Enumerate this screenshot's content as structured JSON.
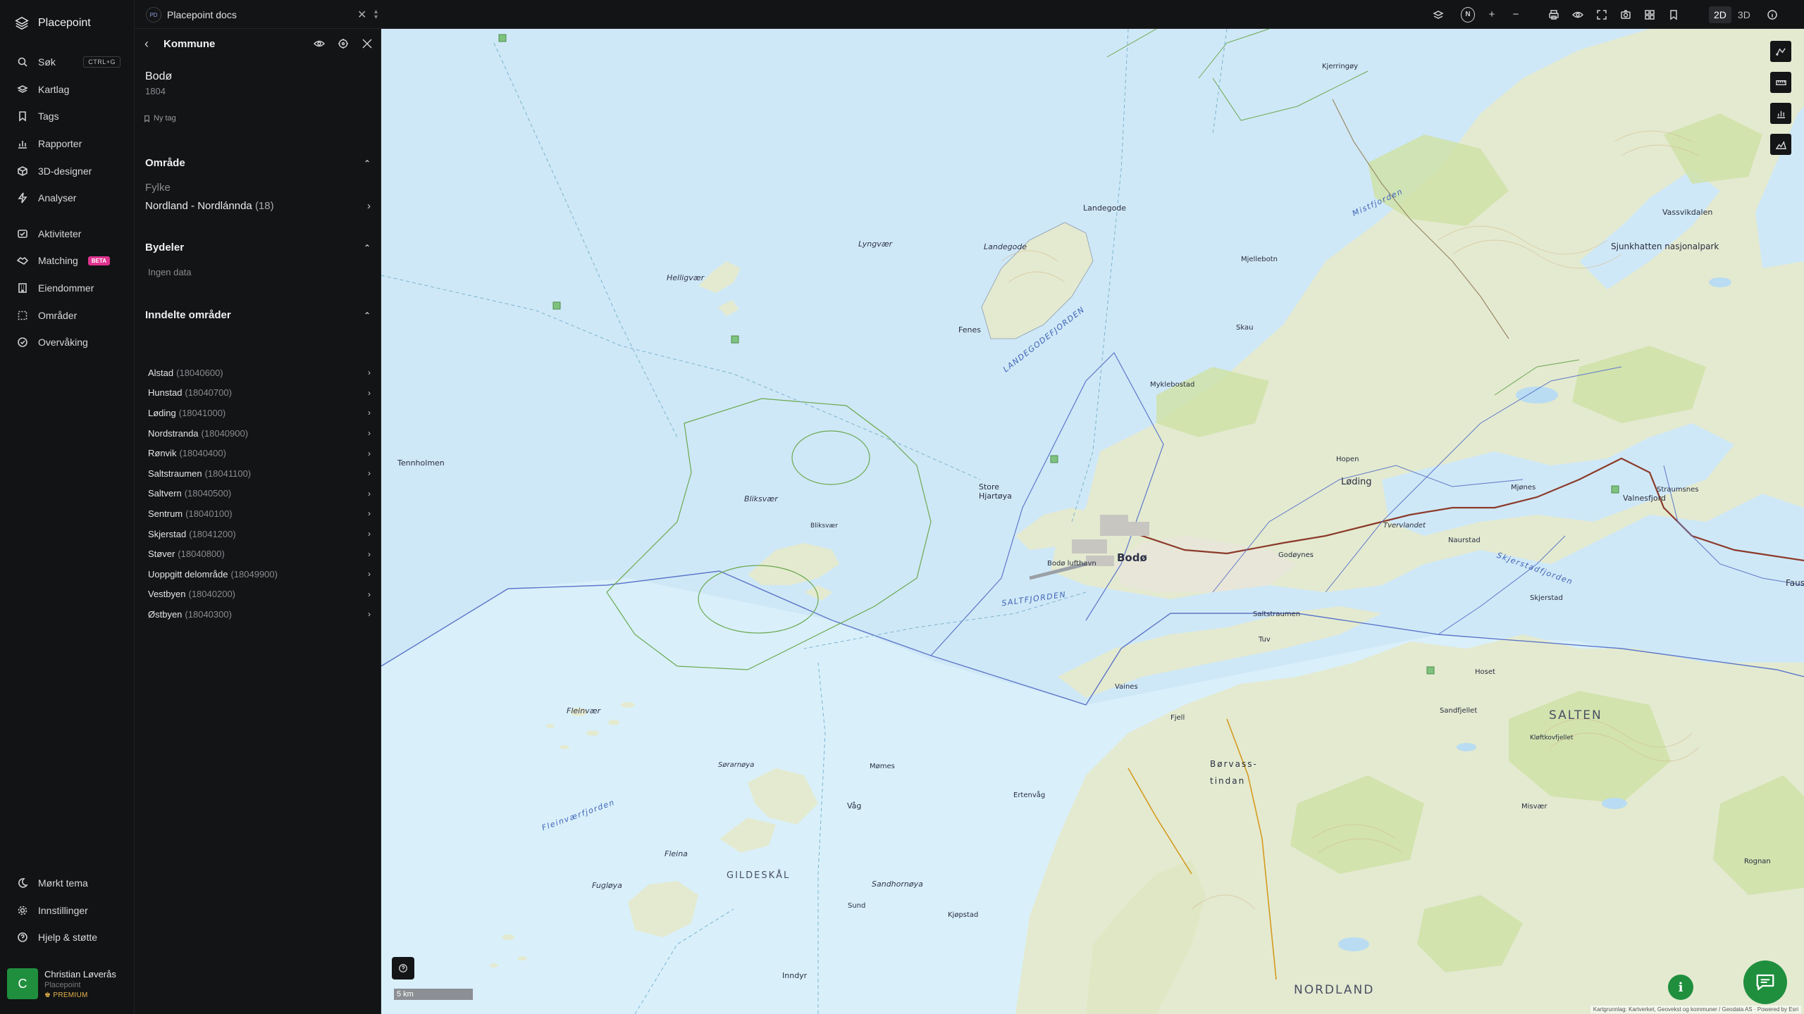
{
  "app": {
    "name": "Placepoint"
  },
  "nav": {
    "items": [
      {
        "label": "Søk",
        "icon": "search-icon",
        "shortcut": "CTRL+G"
      },
      {
        "label": "Kartlag",
        "icon": "layers-icon"
      },
      {
        "label": "Tags",
        "icon": "bookmark-icon"
      },
      {
        "label": "Rapporter",
        "icon": "chart-icon"
      },
      {
        "label": "3D-designer",
        "icon": "cube-icon"
      },
      {
        "label": "Analyser",
        "icon": "bolt-icon"
      }
    ],
    "items2": [
      {
        "label": "Aktiviteter",
        "icon": "activity-icon"
      },
      {
        "label": "Matching",
        "icon": "handshake-icon",
        "badge": "BETA"
      },
      {
        "label": "Eiendommer",
        "icon": "building-icon"
      },
      {
        "label": "Områder",
        "icon": "area-icon"
      },
      {
        "label": "Overvåking",
        "icon": "monitor-icon"
      }
    ],
    "footer": [
      {
        "label": "Mørkt tema",
        "icon": "moon-icon"
      },
      {
        "label": "Innstillinger",
        "icon": "gear-icon"
      },
      {
        "label": "Hjelp & støtte",
        "icon": "help-icon"
      }
    ]
  },
  "user": {
    "initial": "C",
    "name": "Christian Løverås",
    "org": "Placepoint",
    "plan": "PREMIUM"
  },
  "topbar": {
    "doc_badge": "PD",
    "doc_title": "Placepoint docs",
    "compass": "N",
    "view_2d": "2D",
    "view_3d": "3D"
  },
  "panel": {
    "title": "Kommune",
    "kommune_name": "Bodø",
    "kommune_number": "1804",
    "new_tag": "Ny tag",
    "omrade": {
      "title": "Område",
      "fylke_label": "Fylke",
      "fylke_value": "Nordland - Nordlánnda",
      "fylke_count": "(18)"
    },
    "bydeler": {
      "title": "Bydeler",
      "empty": "Ingen data"
    },
    "inndelte": {
      "title": "Inndelte områder",
      "items": [
        {
          "name": "Alstad",
          "code": "(18040600)"
        },
        {
          "name": "Hunstad",
          "code": "(18040700)"
        },
        {
          "name": "Løding",
          "code": "(18041000)"
        },
        {
          "name": "Nordstranda",
          "code": "(18040900)"
        },
        {
          "name": "Rønvik",
          "code": "(18040400)"
        },
        {
          "name": "Saltstraumen",
          "code": "(18041100)"
        },
        {
          "name": "Saltvern",
          "code": "(18040500)"
        },
        {
          "name": "Sentrum",
          "code": "(18040100)"
        },
        {
          "name": "Skjerstad",
          "code": "(18041200)"
        },
        {
          "name": "Støver",
          "code": "(18040800)"
        },
        {
          "name": "Uoppgitt delområde",
          "code": "(18049900)"
        },
        {
          "name": "Vestbyen",
          "code": "(18040200)"
        },
        {
          "name": "Østbyen",
          "code": "(18040300)"
        }
      ]
    }
  },
  "map": {
    "labels": {
      "bodo": "Bodø",
      "salten": "SALTEN",
      "nordland": "NORDLAND",
      "gildeskal": "GILDESKÅL",
      "landegode": "Landegode",
      "landegode_pt": "Landegode",
      "helligvaer": "Helligvær",
      "lyngvaer": "Lyngvær",
      "tennholmen": "Tennholmen",
      "bliksvaer": "Bliksvær",
      "bliksvaer2": "Bliksvær",
      "fenes": "Fenes",
      "store_hjartoya": "Store Hjartøya",
      "bodo_lufthavn": "Bodø lufthavn",
      "loding": "Løding",
      "valnesfjord": "Valnesfjord",
      "saltfjorden": "SALTFJORDEN",
      "landegodefjorden": "LANDEGODEFJORDEN",
      "mistfjorden": "Mistfjorden",
      "skjerstadfjorden": "Skjerstadfjorden",
      "fleinvaerfjorden": "Fleinværfjorden",
      "sjunkhatten": "Sjunkhatten nasjonalpark",
      "kjerringoy": "Kjerringøy",
      "vassvikdalen": "Vassvikdalen",
      "fleinvaer": "Fleinvær",
      "soromoya": "Sørarnøya",
      "fugloya": "Fugløya",
      "fleina": "Fleina",
      "sandhornoya": "Sandhornøya",
      "mames": "Mømes",
      "vag": "Våg",
      "inndyr": "Inndyr",
      "sund": "Sund",
      "kjopstad": "Kjøpstad",
      "tuv": "Tuv",
      "fjell": "Fjell",
      "vaines": "Vaines",
      "skau": "Skau",
      "mjellebotn": "Mjellebotn",
      "myklebostad": "Myklebostad",
      "hopen": "Hopen",
      "naurstad": "Naurstad",
      "godoynes": "Godøynes",
      "saltstraumen": "Saltstraumen",
      "skjerstad": "Skjerstad",
      "misvaer": "Misvær",
      "rognan": "Rognan",
      "mjones": "Mjønes",
      "borvass_tindan": "Børvass-tindan",
      "ertenvag": "Ertenvåg",
      "kloftkovfjellet": "Kløftkovfjellet",
      "hoset": "Hoset",
      "tverrlandet": "Tvervlandet",
      "sandfjellet": "Sandfjellet",
      "faus": "Faus",
      "straumnes": "Straumsnes",
      "fauske_km": "5 km",
      "scale": "5 km",
      "attrib": "Kartgrunnlag: Kartverket, Geovekst og kommuner / Geodata AS · Powered by Esri"
    }
  },
  "colors": {
    "sea": "#cfe8f7",
    "land": "#e6ecd2",
    "accent": "#1f8f3e",
    "beta": "#e0338f",
    "premium": "#e3b34b"
  }
}
